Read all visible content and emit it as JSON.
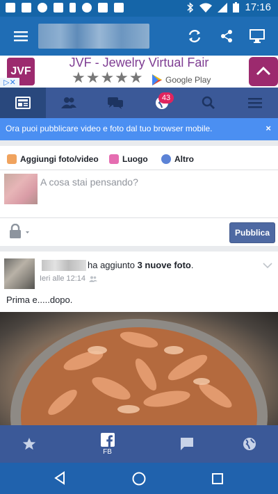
{
  "status_bar": {
    "time": "17:16",
    "left_icons": [
      "gmail-icon",
      "gallery-icon",
      "play-icon",
      "lock-icon",
      "battery-saver-icon",
      "circle-icon",
      "bag-icon",
      "check-icon"
    ],
    "right_icons": [
      "bluetooth-icon",
      "wifi-icon",
      "signal-icon",
      "battery-icon"
    ]
  },
  "toolbar": {
    "icons": [
      "menu-icon",
      "refresh-icon",
      "share-icon",
      "desktop-icon"
    ]
  },
  "ad": {
    "logo_text": "JVF",
    "title": "JVF - Jewelry Virtual Fair",
    "stars": "★★★★★",
    "store": "Google Play",
    "colors": {
      "brand": "#9c2a6e",
      "title": "#7e3c92"
    }
  },
  "fb_nav": {
    "tabs": [
      "news-feed-icon",
      "friends-icon",
      "messages-icon",
      "notifications-globe-icon",
      "search-icon",
      "menu-icon"
    ],
    "notifications_badge": "43"
  },
  "notice": {
    "text": "Ora puoi pubblicare video e foto dal tuo browser mobile.",
    "close": "×"
  },
  "composer": {
    "actions": [
      {
        "label": "Aggiungi foto/video",
        "icon": "photo-icon"
      },
      {
        "label": "Luogo",
        "icon": "location-icon"
      },
      {
        "label": "Altro",
        "icon": "smiley-icon"
      }
    ],
    "placeholder": "A cosa stai pensando?",
    "publish": "Pubblica"
  },
  "post": {
    "action_text": "ha aggiunto ",
    "action_bold": "3 nuove foto",
    "action_end": ".",
    "time": "Ieri alle 12:14",
    "text": "Prima e.....dopo."
  },
  "bottom_tabs": {
    "items": [
      "star-icon",
      "facebook-icon",
      "chat-icon",
      "globe-icon"
    ],
    "fb_label": "FB"
  },
  "android_nav": [
    "back-icon",
    "home-icon",
    "recents-icon"
  ],
  "colors": {
    "fb_blue": "#3b5998",
    "status_bar": "#1565a8",
    "toolbar": "#1f6db5",
    "notice": "#4b8ff2"
  }
}
